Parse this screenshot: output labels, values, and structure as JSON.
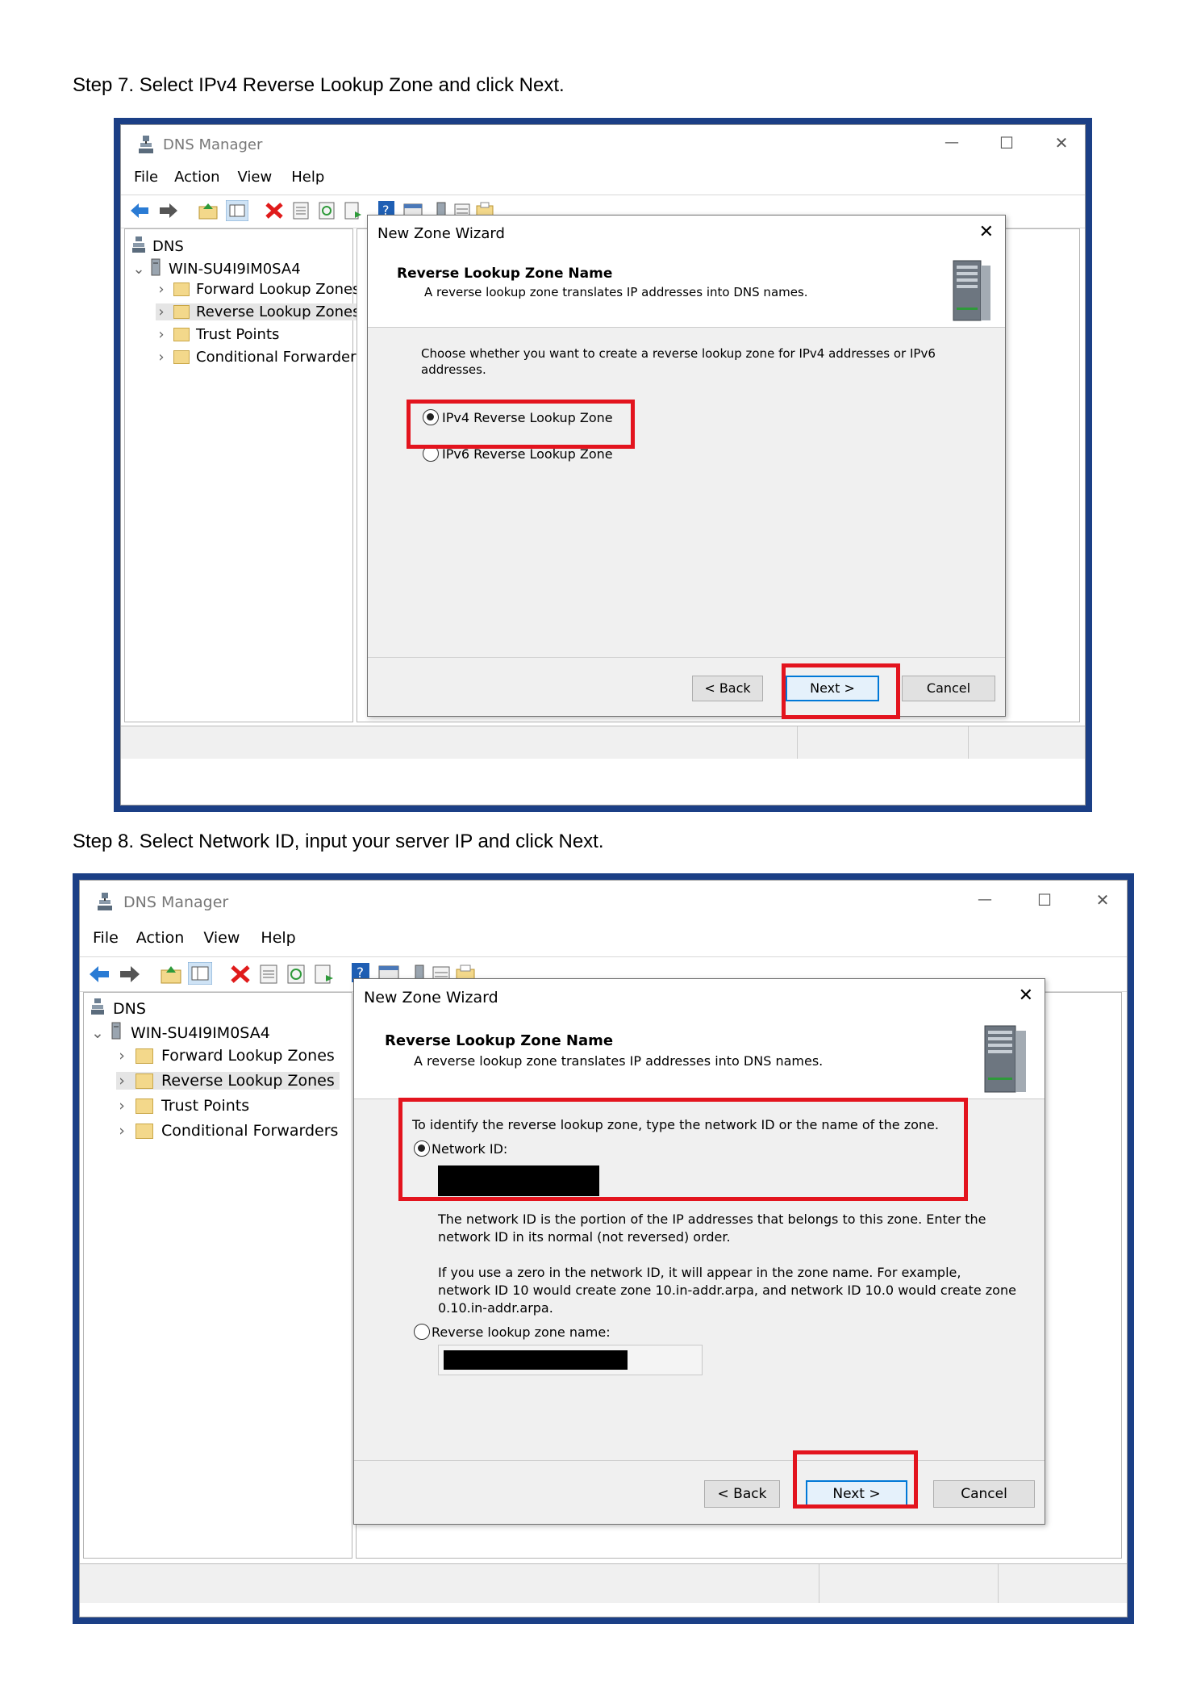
{
  "steps": [
    {
      "caption": "Step 7. Select IPv4 Reverse Lookup Zone and click Next.",
      "window": {
        "title": "DNS Manager",
        "controls": {
          "minimize": "—",
          "maximize": "☐",
          "close": "✕"
        },
        "menu": [
          "File",
          "Action",
          "View",
          "Help"
        ],
        "tree": {
          "root": "DNS",
          "server": "WIN-SU4I9IM0SA4",
          "items": [
            "Forward Lookup Zones",
            "Reverse Lookup Zones",
            "Trust Points",
            "Conditional Forwarders"
          ],
          "selected_index": 1
        }
      },
      "wizard": {
        "title": "New Zone Wizard",
        "close": "✕",
        "header_title": "Reverse Lookup Zone Name",
        "header_subtitle": "A reverse lookup zone translates IP addresses into DNS names.",
        "prompt": "Choose whether you want to create a reverse lookup zone for IPv4 addresses or IPv6 addresses.",
        "options": [
          {
            "label": "IPv4 Reverse Lookup Zone",
            "selected": true
          },
          {
            "label": "IPv6 Reverse Lookup Zone",
            "selected": false
          }
        ],
        "buttons": {
          "back": "< Back",
          "next": "Next >",
          "cancel": "Cancel"
        }
      }
    },
    {
      "caption": "Step 8. Select Network ID, input your server IP and click Next.",
      "window": {
        "title": "DNS Manager",
        "controls": {
          "minimize": "—",
          "maximize": "☐",
          "close": "✕"
        },
        "menu": [
          "File",
          "Action",
          "View",
          "Help"
        ],
        "tree": {
          "root": "DNS",
          "server": "WIN-SU4I9IM0SA4",
          "items": [
            "Forward Lookup Zones",
            "Reverse Lookup Zones",
            "Trust Points",
            "Conditional Forwarders"
          ],
          "selected_index": 1
        }
      },
      "wizard": {
        "title": "New Zone Wizard",
        "close": "✕",
        "header_title": "Reverse Lookup Zone Name",
        "header_subtitle": "A reverse lookup zone translates IP addresses into DNS names.",
        "intro": "To identify the reverse lookup zone, type the network ID or the name of the zone.",
        "network_id_label": "Network ID:",
        "network_id_help": "The network ID is the portion of the IP addresses that belongs to this zone. Enter the network ID in its normal (not reversed) order.",
        "zero_help": "If you use a zero in the network ID, it will appear in the zone name. For example, network ID 10 would create zone 10.in-addr.arpa, and network ID 10.0 would create zone 0.10.in-addr.arpa.",
        "zone_name_label": "Reverse lookup zone name:",
        "network_id_selected": true,
        "buttons": {
          "back": "< Back",
          "next": "Next >",
          "cancel": "Cancel"
        }
      }
    }
  ],
  "colors": {
    "highlight": "#e3141e",
    "frame": "#1b3f86",
    "primary_button_border": "#0078d7"
  }
}
